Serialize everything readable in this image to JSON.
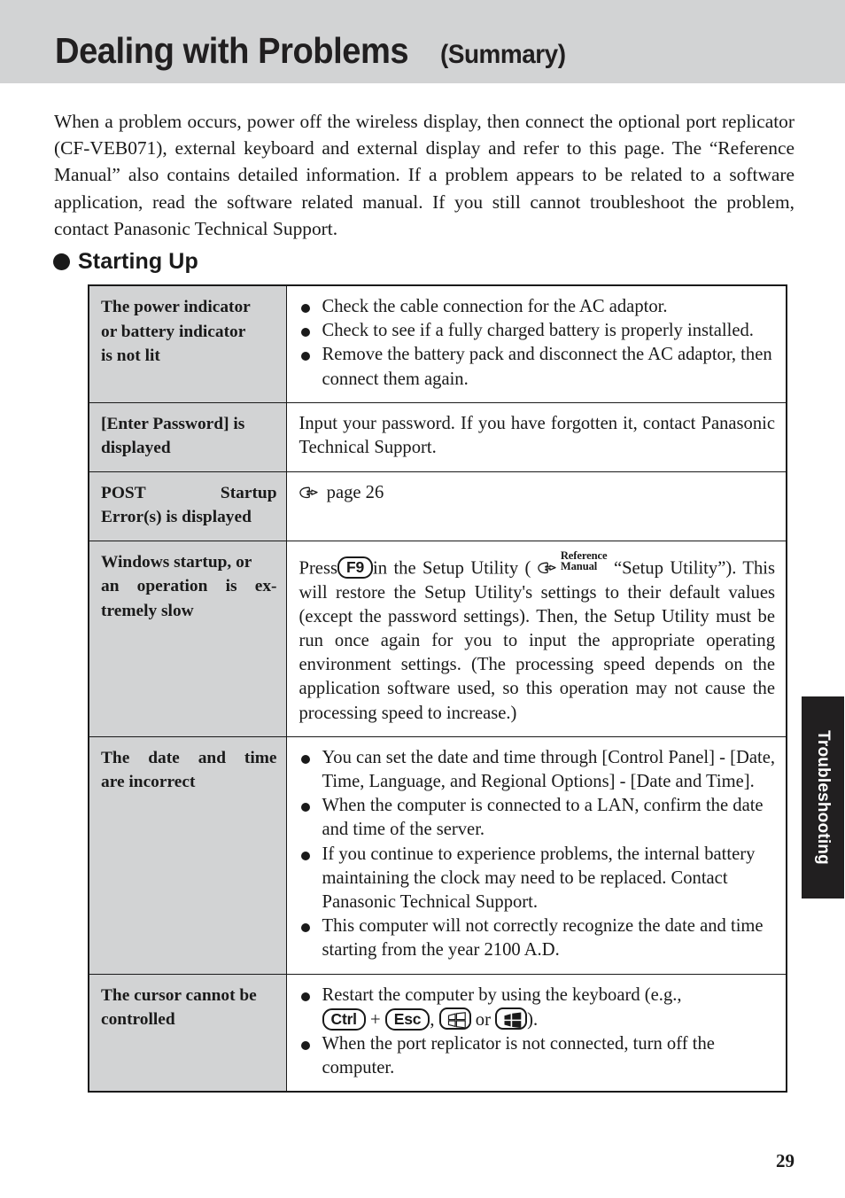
{
  "header": {
    "title_main": "Dealing with Problems",
    "title_sub": "(Summary)"
  },
  "intro": {
    "paragraph": "When a problem occurs, power off the wireless display, then connect the optional port replicator (CF-VEB071), external keyboard and external display and refer to this page.  The “Reference Manual” also contains detailed information.  If a problem appears to be related to a software application, read the software related manual.  If you still cannot troubleshoot the problem, contact Panasonic Technical Support."
  },
  "section": {
    "bullet_icon": "filled-circle-icon",
    "label": "Starting Up"
  },
  "table": {
    "rows": [
      {
        "problem_lines": [
          "The power indicator",
          "or battery indicator",
          "is not lit"
        ],
        "solution_type": "bullets",
        "bullets": [
          "Check the cable connection for the AC adaptor.",
          "Check to see if a fully charged battery is properly installed.",
          "Remove the battery pack and disconnect the AC adaptor, then connect them again."
        ]
      },
      {
        "problem_lines": [
          "[Enter Password] is",
          "displayed"
        ],
        "solution_type": "paragraph",
        "paragraph": "Input your password.  If you have forgotten it, contact Panasonic Technical Support."
      },
      {
        "problem_lines": [
          "POST Startup",
          "Error(s) is displayed"
        ],
        "problem_spread_first": true,
        "solution_type": "page-ref",
        "hand_icon": "pointing-hand-icon",
        "page_ref": "page 26"
      },
      {
        "problem_lines": [
          "Windows startup, or",
          "an operation is ex-",
          "tremely slow"
        ],
        "problem_justify": true,
        "solution_type": "setup-utility",
        "press_label": "Press",
        "key_f9": "F9",
        "after_key": "in the Setup Utility (",
        "hand_icon": "pointing-hand-icon",
        "ref_line1": "Reference",
        "ref_line2": "Manual",
        "quoted": "“Setup Utility”).",
        "rest": "This will restore the Setup Utility's settings to their default values (except the password settings).  Then, the Setup Utility must be run once again for you to input the appropriate operating environment settings.  (The processing speed depends on the application software used, so this operation may not cause the processing speed to increase.)"
      },
      {
        "problem_lines": [
          "The date and time",
          "are incorrect"
        ],
        "problem_spread_first": true,
        "solution_type": "bullets",
        "bullets": [
          "You can set the date and time through [Control Panel] - [Date, Time, Language, and Regional Options] - [Date and Time].",
          "When the computer is connected to a LAN, confirm the date and time of the server.",
          "If you continue to experience problems, the internal battery maintaining the clock may need to be replaced.  Contact Panasonic Technical Support.",
          "This computer will not correctly recognize the date and time starting from the year 2100 A.D."
        ]
      },
      {
        "problem_lines": [
          "The cursor cannot be",
          "controlled"
        ],
        "solution_type": "cursor",
        "line1": "Restart the computer by using the keyboard (e.g.,",
        "key_ctrl": "Ctrl",
        "plus": "+",
        "key_esc": "Esc",
        "comma": ",",
        "key_win_outline": "windows-key-outline-icon",
        "or": "or",
        "key_win_solid": "windows-key-solid-icon",
        "closing": ").",
        "bullet2": "When the port replicator is not connected, turn off the computer."
      }
    ]
  },
  "side_tab": {
    "label": "Troubleshooting"
  },
  "footer": {
    "page_number": "29"
  },
  "colors": {
    "header_band": "#d2d3d4",
    "cell_gray": "#d2d3d4",
    "ink": "#1a1a1a",
    "tab_black": "#211f20"
  }
}
